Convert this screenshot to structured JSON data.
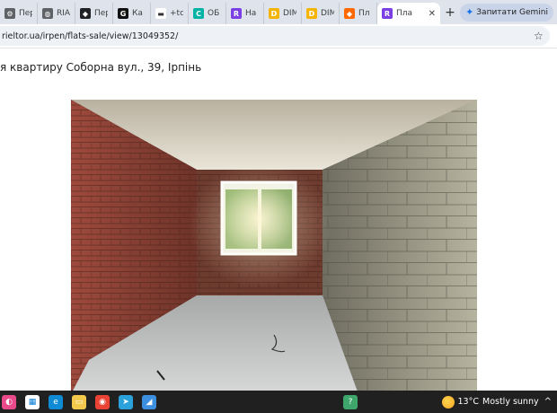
{
  "browser": {
    "tabs": [
      {
        "label": "Пер",
        "favicon_color": "#5f6368",
        "favicon_glyph": "⚙"
      },
      {
        "label": "RIA",
        "favicon_color": "#5f6368",
        "favicon_glyph": "◍"
      },
      {
        "label": "Пер",
        "favicon_color": "#202124",
        "favicon_glyph": "◆"
      },
      {
        "label": "Ка",
        "favicon_color": "#111111",
        "favicon_glyph": "G"
      },
      {
        "label": "+tc",
        "favicon_color": "#ffffff",
        "favicon_glyph": "▬"
      },
      {
        "label": "ОБ",
        "favicon_color": "#00b3a4",
        "favicon_glyph": "C"
      },
      {
        "label": "На",
        "favicon_color": "#7b3fe4",
        "favicon_glyph": "R"
      },
      {
        "label": "DIM",
        "favicon_color": "#f5b400",
        "favicon_glyph": "D"
      },
      {
        "label": "DIM",
        "favicon_color": "#f5b400",
        "favicon_glyph": "D"
      },
      {
        "label": "Пл",
        "favicon_color": "#ff6a00",
        "favicon_glyph": "◆"
      }
    ],
    "active_tab": {
      "label": "Пла",
      "favicon_color": "#7b3fe4",
      "favicon_glyph": "R"
    },
    "close_glyph": "✕",
    "new_tab_glyph": "+",
    "gemini_label": "Запитати Gemini",
    "url": "rieltor.ua/irpen/flats-sale/view/13049352/",
    "bookmark_glyph": "☆"
  },
  "page": {
    "heading": "я квартиру Соборна вул., 39, Ірпінь"
  },
  "taskbar": {
    "apps": [
      {
        "name": "copilot-icon",
        "color": "#e84a8a",
        "glyph": "◐"
      },
      {
        "name": "store-icon",
        "color": "#ffffff",
        "glyph": "▦"
      },
      {
        "name": "edge-icon",
        "color": "#0f8bd6",
        "glyph": "e"
      },
      {
        "name": "file-explorer-icon",
        "color": "#f2c94c",
        "glyph": "▭"
      },
      {
        "name": "chrome-icon",
        "color": "#ea4335",
        "glyph": "◉"
      },
      {
        "name": "telegram-icon",
        "color": "#2aa1da",
        "glyph": "➤"
      },
      {
        "name": "app-icon",
        "color": "#3d8fe0",
        "glyph": "◢"
      },
      {
        "name": "help-icon",
        "color": "#3fa66b",
        "glyph": "?"
      }
    ],
    "weather_temp": "13°C",
    "weather_desc": "Mostly sunny",
    "tray_glyph": "^"
  }
}
